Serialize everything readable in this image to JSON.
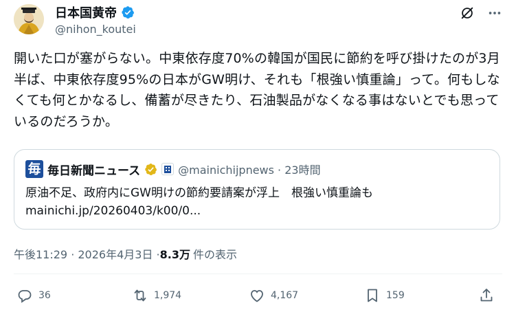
{
  "author": {
    "display_name": "日本国黄帝",
    "handle": "@nihon_koutei",
    "avatar_icon": "emperor-portrait-icon",
    "verified_color": "#1d9bf0"
  },
  "top_actions": {
    "grok_icon": "grok-icon",
    "more_icon": "more-horizontal-icon"
  },
  "tweet": {
    "text": "開いた口が塞がらない。中東依存度70%の韓国が国民に節約を呼び掛けたのが3月半ば、中東依存度95%の日本がGW明け、それも「根強い慎重論」って。何もしなくても何とかなるし、備蓄が尽きたり、石油製品がなくなる事はないとでも思っているのだろうか。"
  },
  "quote": {
    "logo_char": "毎",
    "name": "毎日新聞ニュース",
    "handle_time": "@mainichijpnews · 23時間",
    "text": "原油不足、政府内にGW明けの節約要請案が浮上　根強い慎重論も\nmainichi.jp/20260403/k00/0..."
  },
  "meta": {
    "timestamp": "午後11:29 · 2026年4月3日 · ",
    "views_count": "8.3万",
    "views_label": "件の表示"
  },
  "actions": {
    "replies": "36",
    "reposts": "1,974",
    "likes": "4,167",
    "bookmarks": "159"
  },
  "colors": {
    "text": "#0f1419",
    "secondary": "#536471",
    "border": "#cfd9de",
    "verified_blue": "#1d9bf0",
    "verified_gold": "#e2b719",
    "mainichi_blue": "#1d4f9c"
  }
}
